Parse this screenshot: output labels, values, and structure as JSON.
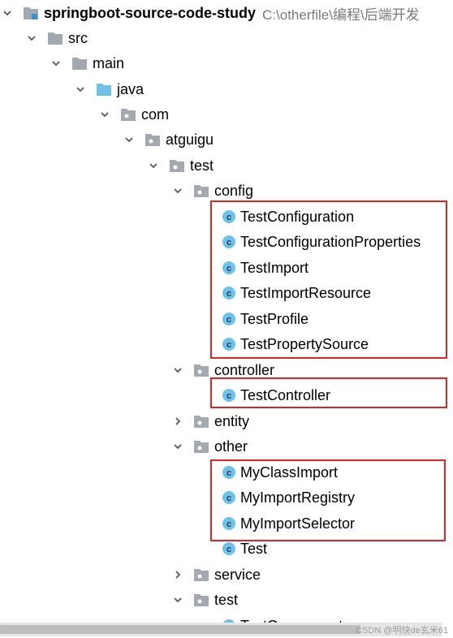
{
  "project": {
    "name": "springboot-source-code-study",
    "path": "C:\\otherfile\\编程\\后端开发"
  },
  "tree": {
    "src": "src",
    "main": "main",
    "java": "java",
    "com": "com",
    "atguigu": "atguigu",
    "test": "test",
    "config": "config",
    "config_classes": [
      "TestConfiguration",
      "TestConfigurationProperties",
      "TestImport",
      "TestImportResource",
      "TestProfile",
      "TestPropertySource"
    ],
    "controller": "controller",
    "controller_classes": [
      "TestController"
    ],
    "entity": "entity",
    "other": "other",
    "other_classes": [
      "MyClassImport",
      "MyImportRegistry",
      "MyImportSelector",
      "Test"
    ],
    "service": "service",
    "test2": "test",
    "test2_classes": [
      "TestComponent"
    ]
  },
  "colors": {
    "folder": "#a3a9b0",
    "source_folder": "#6fc1e8",
    "class_icon": "#6fc1e8",
    "highlight_box": "#e02424"
  },
  "watermark": "CSDN @明快de玄米61"
}
